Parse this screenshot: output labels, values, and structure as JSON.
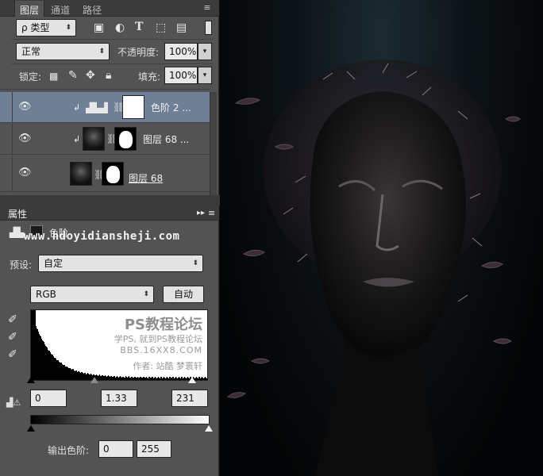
{
  "layers_panel": {
    "tabs": [
      "图层",
      "通道",
      "路径"
    ],
    "filter": {
      "label": "ρ 类型"
    },
    "blend_mode": {
      "value": "正常"
    },
    "opacity": {
      "label": "不透明度:",
      "value": "100%"
    },
    "lock": {
      "label": "锁定:"
    },
    "fill": {
      "label": "填充:",
      "value": "100%"
    },
    "layers": [
      {
        "name": "色阶 2 ...",
        "type": "adjustment-levels",
        "clipped": true,
        "selected": true
      },
      {
        "name": "图层 68 ...",
        "type": "pixel-with-mask",
        "clipped": true,
        "selected": false
      },
      {
        "name": "图层 68",
        "type": "pixel-with-mask",
        "clipped": false,
        "selected": false
      }
    ]
  },
  "properties_panel": {
    "title": "属性",
    "adjustment_title": "色阶",
    "watermark_url": "www.hdoyidiansheji.com",
    "preset": {
      "label": "预设:",
      "value": "自定"
    },
    "channel": {
      "value": "RGB"
    },
    "auto_button": "自动",
    "histogram_watermark": {
      "line1": "PS教程论坛",
      "line2": "学PS, 就到PS教程论坛",
      "line3": "BBS.16XX8.COM",
      "line4": "作者: 站酷 梦寰轩"
    },
    "input_levels": {
      "black": "0",
      "gamma": "1.33",
      "white": "231"
    },
    "output_levels": {
      "label": "输出色阶:",
      "black": "0",
      "white": "255"
    }
  },
  "colors": {
    "panel_bg": "#535353",
    "panel_header": "#3b3b3b",
    "selected_layer": "#6f7f95",
    "canvas_bg": "#0a0f12"
  }
}
